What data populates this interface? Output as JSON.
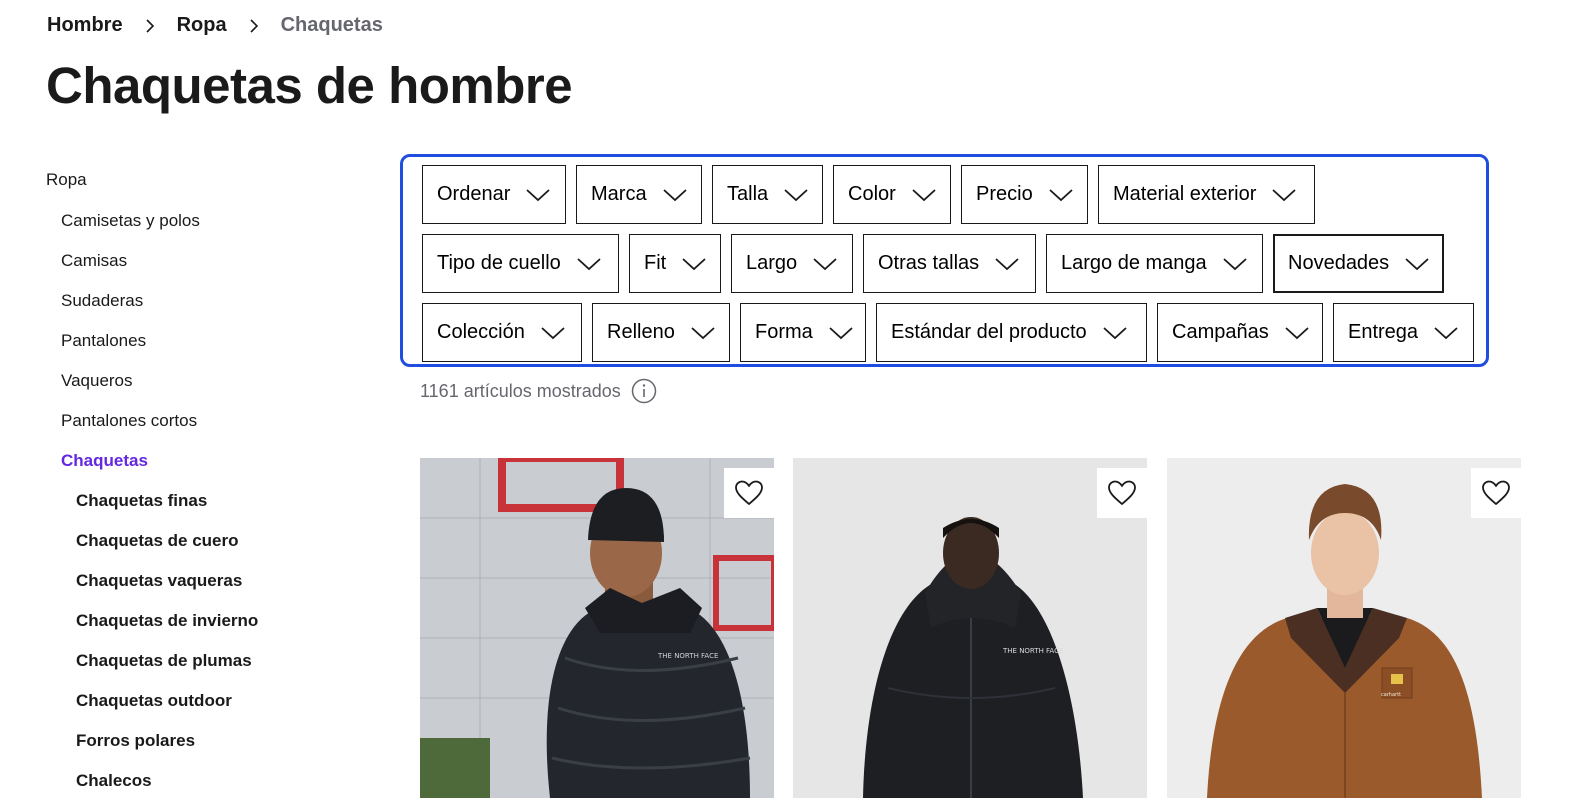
{
  "breadcrumb": {
    "items": [
      "Hombre",
      "Ropa",
      "Chaquetas"
    ]
  },
  "page_title": "Chaquetas de hombre",
  "sidebar": {
    "root": "Ropa",
    "categories": [
      "Camisetas y polos",
      "Camisas",
      "Sudaderas",
      "Pantalones",
      "Vaqueros",
      "Pantalones cortos",
      "Chaquetas"
    ],
    "active": "Chaquetas",
    "subcategories": [
      "Chaquetas finas",
      "Chaquetas de cuero",
      "Chaquetas vaqueras",
      "Chaquetas de invierno",
      "Chaquetas de plumas",
      "Chaquetas outdoor",
      "Forros polares",
      "Chalecos"
    ]
  },
  "filters": {
    "row1": [
      "Ordenar",
      "Marca",
      "Talla",
      "Color",
      "Precio",
      "Material exterior"
    ],
    "row2": [
      "Tipo de cuello",
      "Fit",
      "Largo",
      "Otras tallas",
      "Largo de manga",
      "Novedades"
    ],
    "row3": [
      "Colección",
      "Relleno",
      "Forma",
      "Estándar del producto",
      "Campañas",
      "Entrega"
    ]
  },
  "results": {
    "count_text": "1161 artículos mostrados"
  },
  "products": [
    {
      "brand_logo": "THE NORTH FACE",
      "image": "man-black-puffer-jacket"
    },
    {
      "brand_logo": "THE NORTH FACE",
      "image": "man-black-rain-jacket"
    },
    {
      "brand_logo": "carhartt",
      "image": "man-brown-work-jacket"
    }
  ],
  "colors": {
    "text": "#1a1a1a",
    "muted": "#66676e",
    "active_link": "#6328e0",
    "highlight_border": "#1f4de0"
  },
  "icons": {
    "breadcrumb_separator": "chevron-right-icon",
    "filter_chevron": "chevron-down-icon",
    "info": "info-icon",
    "wishlist": "heart-outline-icon"
  }
}
